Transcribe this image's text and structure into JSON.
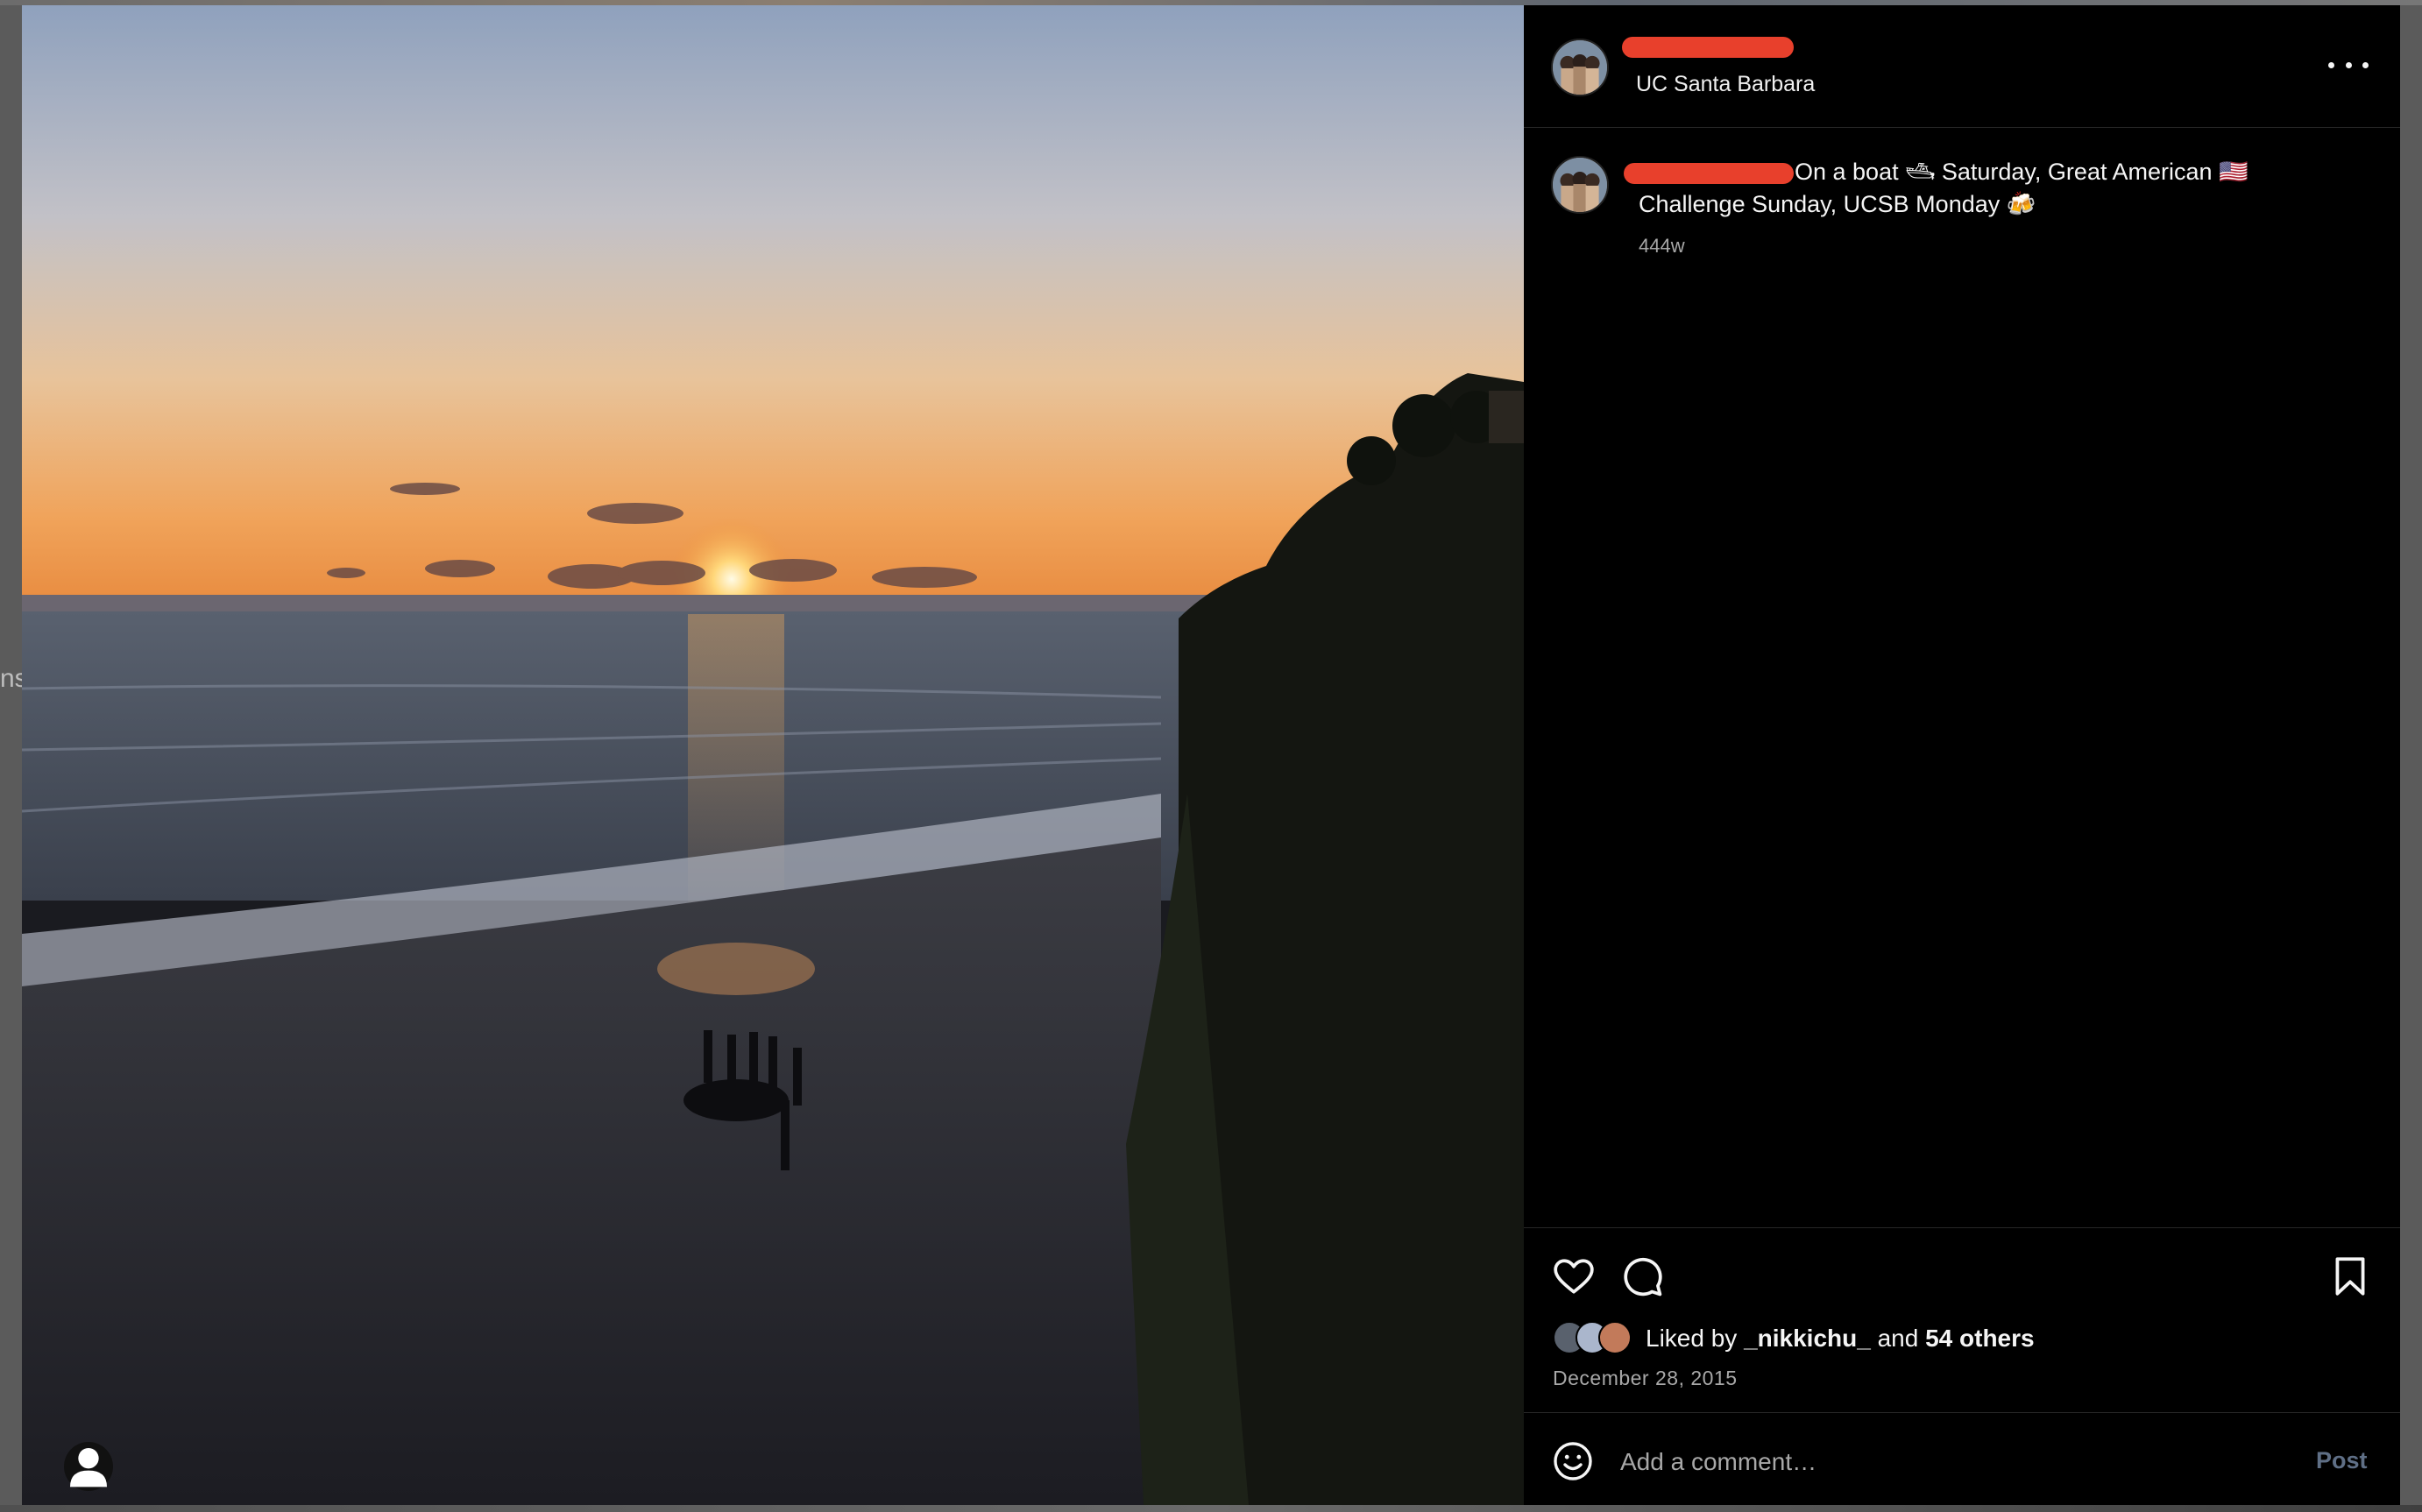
{
  "post": {
    "location": "UC Santa Barbara",
    "caption_text": "On a boat 🛥 Saturday, Great American 🇺🇸 Challenge Sunday, UCSB Monday 🍻",
    "caption_line1": "On a boat 🛥 Saturday, Great American 🇺🇸",
    "caption_line2": "Challenge Sunday, UCSB Monday 🍻",
    "time_ago": "444w",
    "date": "December 28, 2015"
  },
  "likes": {
    "prefix": "Liked by",
    "user": "_nikkichu_",
    "joiner": "and",
    "others": "54 others"
  },
  "comment_box": {
    "placeholder": "Add a comment…",
    "post_label": "Post"
  },
  "background": {
    "edge_text": "ns"
  },
  "icons": {
    "more": "more-horizontal-icon",
    "like": "heart-icon",
    "comment": "comment-bubble-icon",
    "save": "bookmark-icon",
    "emoji": "emoji-smile-icon",
    "profile": "person-icon"
  }
}
